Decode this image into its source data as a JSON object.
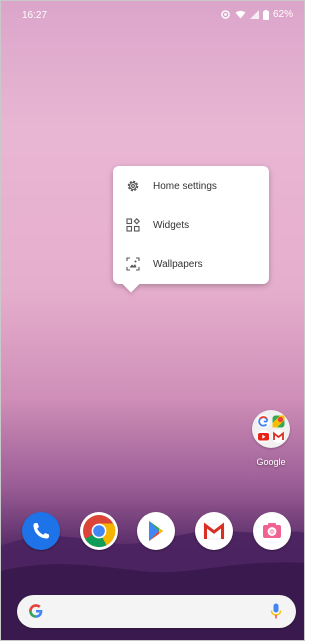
{
  "status_bar": {
    "time": "16:27",
    "battery": "62%"
  },
  "context_menu": {
    "items": [
      {
        "label": "Home settings",
        "icon": "gear-icon"
      },
      {
        "label": "Widgets",
        "icon": "widgets-icon"
      },
      {
        "label": "Wallpapers",
        "icon": "wallpaper-icon"
      }
    ]
  },
  "home": {
    "folder": {
      "label": "Google"
    }
  },
  "dock": {
    "apps": [
      "phone-icon",
      "chrome-icon",
      "play-store-icon",
      "gmail-icon",
      "camera-icon"
    ]
  },
  "search_bar": {
    "left_icon": "google-g-icon",
    "right_icon": "mic-icon"
  },
  "colors": {
    "wallpaper_top": "#dba5ca",
    "wallpaper_bottom": "#3b1c4f",
    "phone_blue": "#1e73e8",
    "accent_red": "#d93025"
  }
}
